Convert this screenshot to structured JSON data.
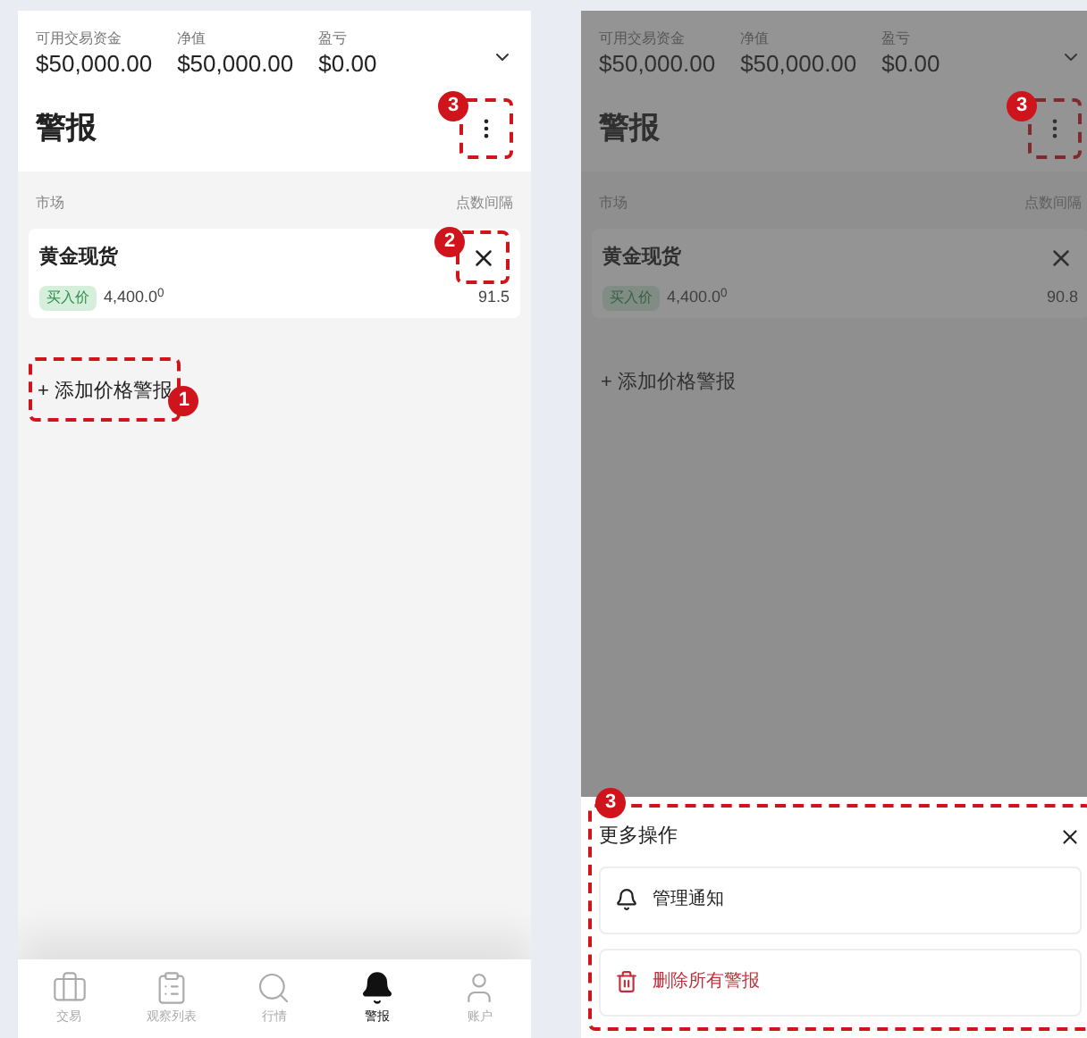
{
  "screens": [
    {
      "account": [
        {
          "label": "可用交易资金",
          "value": "$50,000.00"
        },
        {
          "label": "净值",
          "value": "$50,000.00"
        },
        {
          "label": "盈亏",
          "value": "$0.00"
        }
      ],
      "title": "警报",
      "menu_marker": "3",
      "columns": {
        "market": "市场",
        "interval": "点数间隔"
      },
      "alert": {
        "name": "黄金现货",
        "close_marker": "2",
        "side": "买入价",
        "price": "4,400.0$^{0}$",
        "interval": "91.5"
      },
      "add_alert": {
        "label": "+ 添加价格警报",
        "marker": "1"
      },
      "nav": [
        {
          "label": "交易",
          "selected": false
        },
        {
          "label": "观察列表",
          "selected": false
        },
        {
          "label": "行情",
          "selected": false
        },
        {
          "label": "警报",
          "selected": true
        },
        {
          "label": "账户",
          "selected": false
        }
      ]
    },
    {
      "account": [
        {
          "label": "可用交易资金",
          "value": "$50,000.00"
        },
        {
          "label": "净值",
          "value": "$50,000.00"
        },
        {
          "label": "盈亏",
          "value": "$0.00"
        }
      ],
      "title": "警报",
      "menu_marker": "3",
      "columns": {
        "market": "市场",
        "interval": "点数间隔"
      },
      "alert": {
        "name": "黄金现货",
        "side": "买入价",
        "price": "4,400.0$^{0}$",
        "interval": "90.8"
      },
      "add_alert": {
        "label": "+ 添加价格警报"
      },
      "sheet": {
        "title": "更多操作",
        "marker": "3",
        "items": [
          {
            "kind": "notify",
            "label": "管理通知"
          },
          {
            "kind": "delete",
            "label": "删除所有警报"
          }
        ]
      }
    }
  ]
}
